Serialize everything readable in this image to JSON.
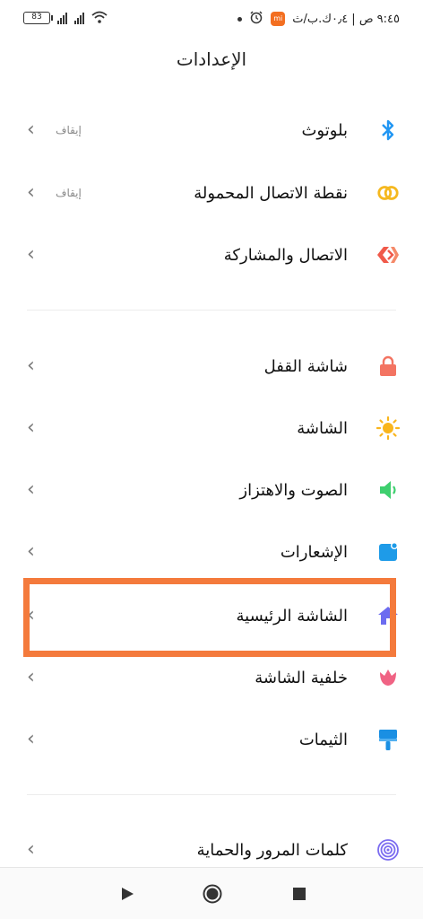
{
  "status_bar": {
    "battery": "83",
    "time": "٩:٤٥ ص | ٠٫٤ك.ب/ث",
    "mi_badge": "mi",
    "icons": [
      "signal-icon",
      "signal-icon",
      "wifi-icon",
      "alarm-icon",
      "mi-app-icon",
      "dot-icon"
    ]
  },
  "header": {
    "title": "الإعدادات"
  },
  "items": [
    {
      "name": "bluetooth",
      "label": "بلوتوث",
      "value": "إيقاف",
      "icon": "bluetooth-icon",
      "color": "#2196f3"
    },
    {
      "name": "hotspot",
      "label": "نقطة الاتصال المحمولة",
      "value": "إيقاف",
      "icon": "hotspot-icon",
      "color": "#f5b81f"
    },
    {
      "name": "connection-sharing",
      "label": "الاتصال والمشاركة",
      "value": "",
      "icon": "connection-sharing-icon",
      "color": "#f05a4a"
    },
    {
      "name": "lock-screen",
      "label": "شاشة القفل",
      "value": "",
      "icon": "lock-icon",
      "color": "#f37462"
    },
    {
      "name": "display",
      "label": "الشاشة",
      "value": "",
      "icon": "sun-icon",
      "color": "#f9b51d"
    },
    {
      "name": "sound",
      "label": "الصوت والاهتزاز",
      "value": "",
      "icon": "speaker-icon",
      "color": "#3ecf6e"
    },
    {
      "name": "notifications",
      "label": "الإشعارات",
      "value": "",
      "icon": "notification-icon",
      "color": "#1e9be8"
    },
    {
      "name": "home-screen",
      "label": "الشاشة الرئيسية",
      "value": "",
      "icon": "home-icon",
      "color": "#6c6cf0"
    },
    {
      "name": "wallpaper",
      "label": "خلفية الشاشة",
      "value": "",
      "icon": "tulip-icon",
      "color": "#f06384"
    },
    {
      "name": "themes",
      "label": "الثيمات",
      "value": "",
      "icon": "brush-icon",
      "color": "#1a8fe3"
    },
    {
      "name": "passwords",
      "label": "كلمات المرور والحماية",
      "value": "",
      "icon": "fingerprint-icon",
      "color": "#7b6cf0"
    }
  ],
  "nav": {
    "back": "back-triangle-icon",
    "home": "home-circle-icon",
    "recents": "recents-square-icon"
  },
  "highlight_color": "#f47a3c"
}
